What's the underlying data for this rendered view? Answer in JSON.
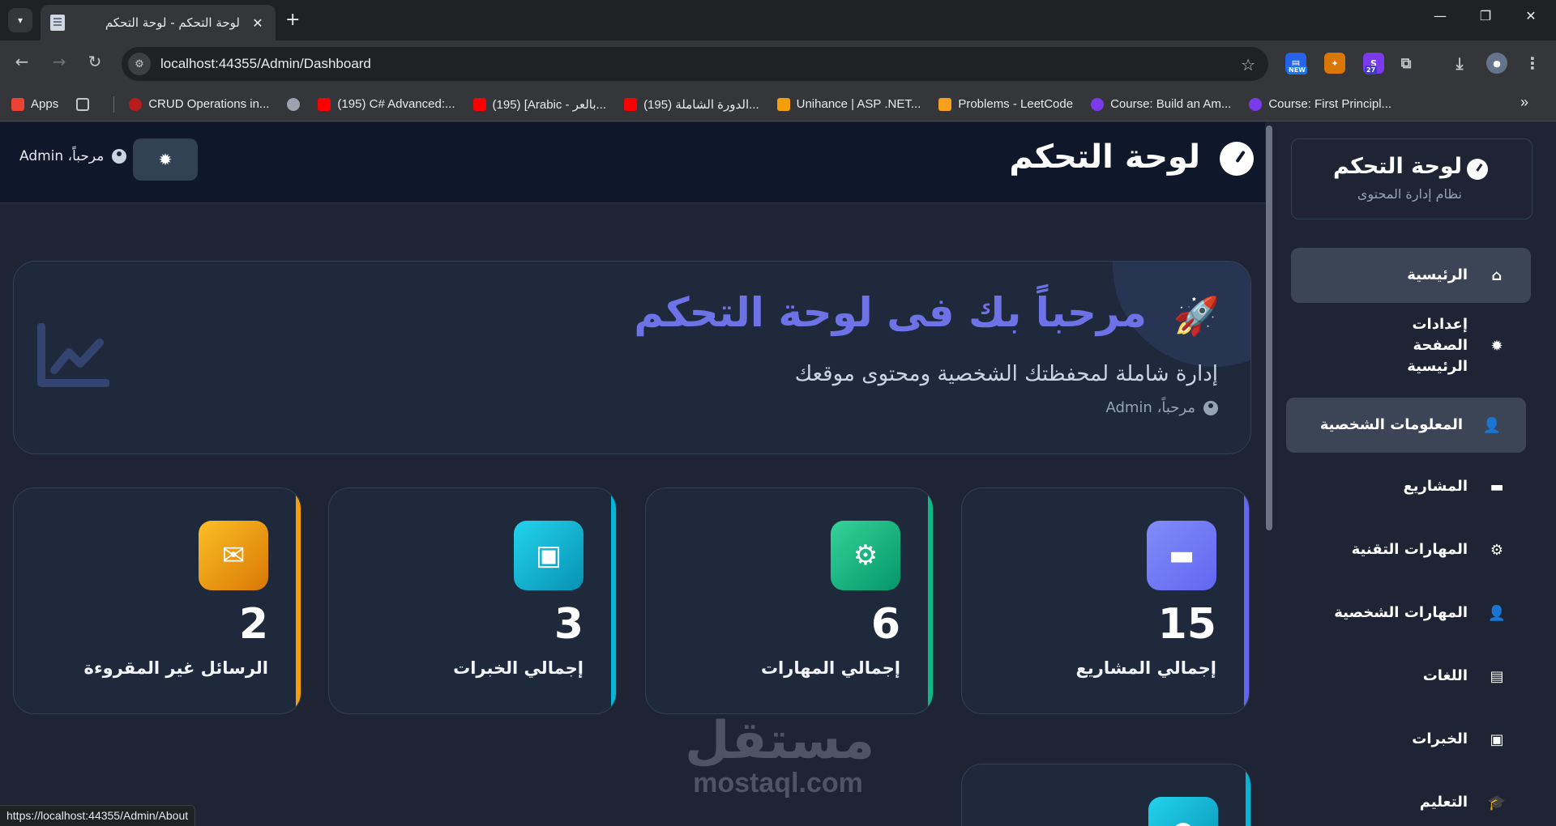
{
  "browser": {
    "tab_title": "لوحة التحكم - لوحة التحكم",
    "url": "localhost:44355/Admin/Dashboard",
    "bookmarks": [
      {
        "label": "Apps",
        "color": "#ea4335"
      },
      {
        "label": "CRUD Operations in...",
        "color": "#b91c1c"
      },
      {
        "label": "(195) C# Advanced:...",
        "color": "#ff0000"
      },
      {
        "label": "(195) [Arabic - بالعر...",
        "color": "#ff0000"
      },
      {
        "label": "(195) الدورة الشاملة...",
        "color": "#ff0000"
      },
      {
        "label": "Unihance | ASP .NET...",
        "color": "#f59e0b"
      },
      {
        "label": "Problems - LeetCode",
        "color": "#f89f1b"
      },
      {
        "label": "Course: Build an Am...",
        "color": "#7c3aed"
      },
      {
        "label": "Course: First Principl...",
        "color": "#7c3aed"
      }
    ],
    "ext_new_badge": "NEW",
    "ext_count_badge": "27",
    "status_url": "https://localhost:44355/Admin/About"
  },
  "header": {
    "title": "لوحة التحكم",
    "greeting": "مرحباً، Admin"
  },
  "welcome": {
    "title": "مرحباً بك فى لوحة التحكم",
    "subtitle": "إدارة شاملة لمحفظتك الشخصية ومحتوى موقعك",
    "user": "مرحباً، Admin"
  },
  "stats": [
    {
      "label": "إجمالي المشاريع",
      "value": "15",
      "color": "#6366f1",
      "icon": "folder-icon"
    },
    {
      "label": "إجمالي المهارات",
      "value": "6",
      "color": "#10b981",
      "icon": "cogs-icon"
    },
    {
      "label": "إجمالي الخبرات",
      "value": "3",
      "color": "#06b6d4",
      "icon": "briefcase-icon"
    },
    {
      "label": "الرسائل غير المقروءة",
      "value": "2",
      "color": "#f59e0b",
      "icon": "envelope-icon"
    }
  ],
  "watermark": {
    "ar": "مستقل",
    "en": "mostaql.com"
  },
  "sidebar": {
    "brand_title": "لوحة التحكم",
    "brand_sub": "نظام إدارة المحتوى",
    "items": [
      {
        "label": "الرئيسية",
        "icon": "home-icon",
        "state": "active"
      },
      {
        "label": "إعدادات الصفحة الرئيسية",
        "icon": "gear-icon",
        "state": ""
      },
      {
        "label": "المعلومات الشخصية",
        "icon": "user-icon",
        "state": "hover"
      },
      {
        "label": "المشاريع",
        "icon": "folder-icon",
        "state": ""
      },
      {
        "label": "المهارات التقنية",
        "icon": "cogs-icon",
        "state": ""
      },
      {
        "label": "المهارات الشخصية",
        "icon": "user-tie-icon",
        "state": ""
      },
      {
        "label": "اللغات",
        "icon": "language-icon",
        "state": ""
      },
      {
        "label": "الخبرات",
        "icon": "briefcase-icon",
        "state": ""
      },
      {
        "label": "التعليم",
        "icon": "graduation-cap-icon",
        "state": ""
      }
    ]
  }
}
